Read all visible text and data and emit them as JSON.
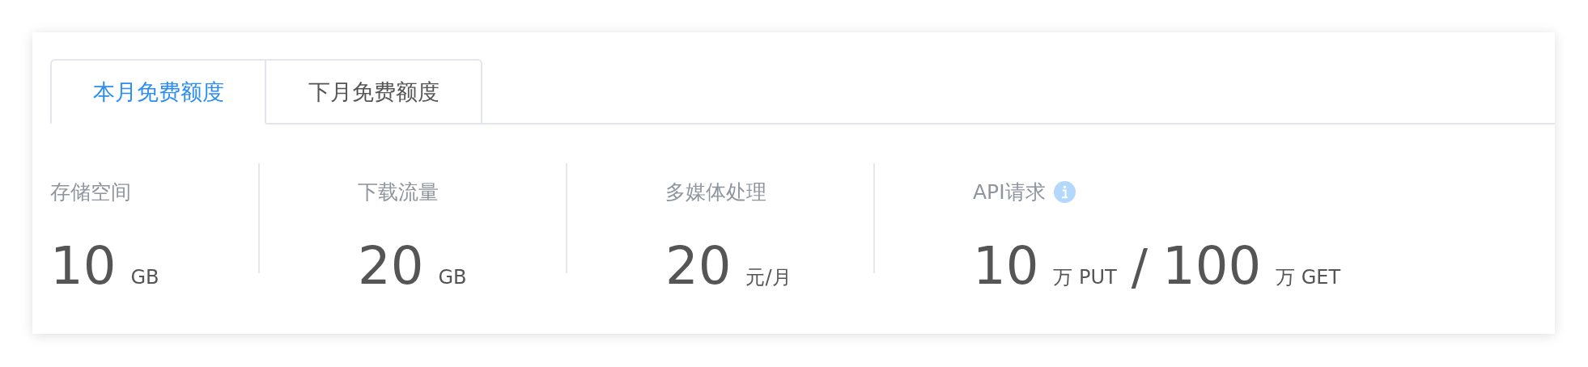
{
  "tabs": [
    {
      "label": "本月免费额度",
      "selected": true
    },
    {
      "label": "下月免费额度",
      "selected": false
    }
  ],
  "stats": [
    {
      "label": "存储空间",
      "info": false,
      "parts": [
        {
          "kind": "number",
          "text": "10"
        },
        {
          "kind": "unit",
          "text": "GB"
        }
      ]
    },
    {
      "label": "下载流量",
      "info": false,
      "parts": [
        {
          "kind": "number",
          "text": "20"
        },
        {
          "kind": "unit",
          "text": "GB"
        }
      ]
    },
    {
      "label": "多媒体处理",
      "info": false,
      "parts": [
        {
          "kind": "number",
          "text": "20"
        },
        {
          "kind": "unit",
          "text": "元/月"
        }
      ]
    },
    {
      "label": "API请求",
      "info": true,
      "parts": [
        {
          "kind": "number",
          "text": "10"
        },
        {
          "kind": "unit",
          "text": "万 PUT"
        },
        {
          "kind": "separator",
          "text": "/"
        },
        {
          "kind": "number",
          "text": "100"
        },
        {
          "kind": "unit",
          "text": "万 GET"
        }
      ]
    }
  ]
}
